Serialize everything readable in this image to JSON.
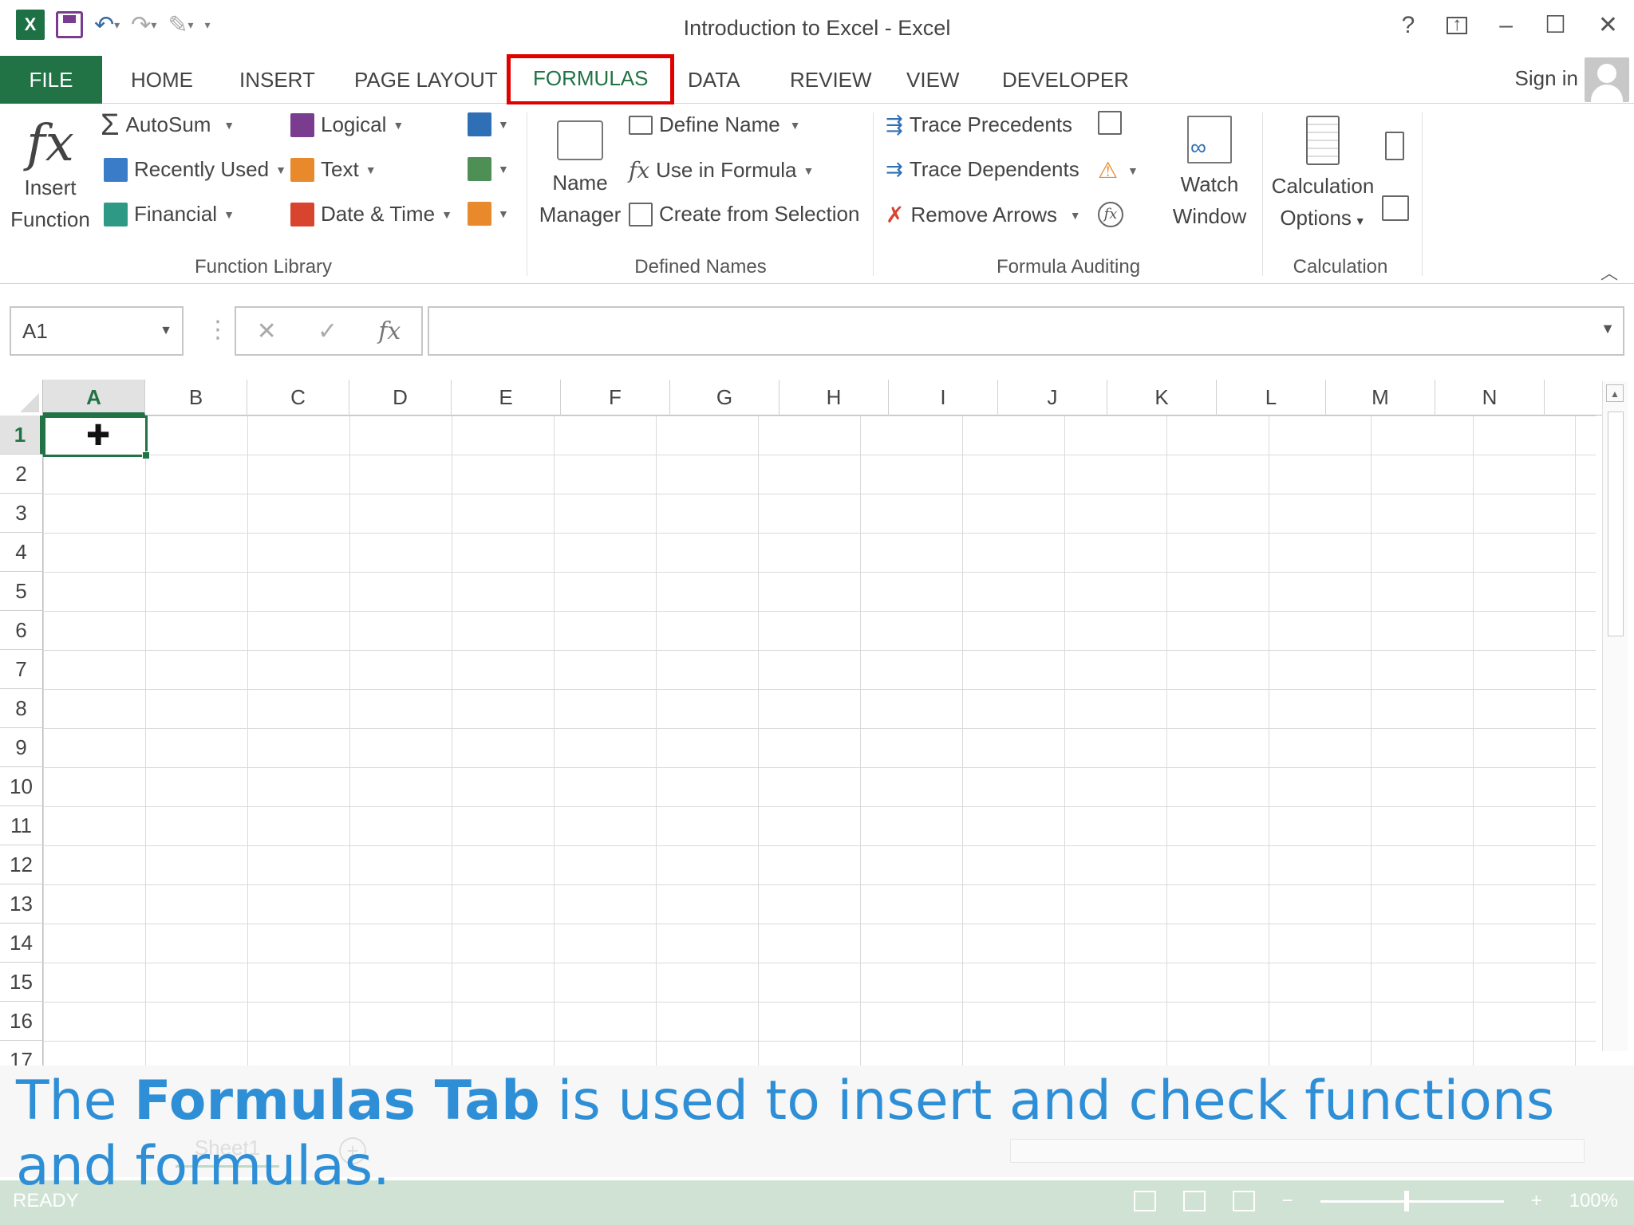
{
  "window": {
    "title": "Introduction to Excel - Excel",
    "help": "?",
    "sign_in": "Sign in"
  },
  "tabs": [
    {
      "label": "FILE"
    },
    {
      "label": "HOME"
    },
    {
      "label": "INSERT"
    },
    {
      "label": "PAGE LAYOUT"
    },
    {
      "label": "FORMULAS",
      "selected": true
    },
    {
      "label": "DATA"
    },
    {
      "label": "REVIEW"
    },
    {
      "label": "VIEW"
    },
    {
      "label": "DEVELOPER"
    }
  ],
  "ribbon": {
    "function_library": {
      "label": "Function Library",
      "insert_function": [
        "Insert",
        "Function"
      ],
      "autosum": "AutoSum",
      "recently_used": "Recently Used",
      "financial": "Financial",
      "logical": "Logical",
      "text": "Text",
      "date_time": "Date & Time"
    },
    "defined_names": {
      "label": "Defined Names",
      "name_manager": [
        "Name",
        "Manager"
      ],
      "define_name": "Define Name",
      "use_in_formula": "Use in Formula",
      "create_from_selection": "Create from Selection"
    },
    "formula_auditing": {
      "label": "Formula Auditing",
      "trace_precedents": "Trace Precedents",
      "trace_dependents": "Trace Dependents",
      "remove_arrows": "Remove Arrows",
      "watch_window": [
        "Watch",
        "Window"
      ]
    },
    "calculation": {
      "label": "Calculation",
      "calculation_options": [
        "Calculation",
        "Options"
      ]
    }
  },
  "formula_bar": {
    "name_box": "A1",
    "cancel": "✕",
    "enter": "✓",
    "fx": "fx",
    "value": ""
  },
  "columns": [
    "A",
    "B",
    "C",
    "D",
    "E",
    "F",
    "G",
    "H",
    "I",
    "J",
    "K",
    "L",
    "M",
    "N"
  ],
  "rows": [
    "1",
    "2",
    "3",
    "4",
    "5",
    "6",
    "7",
    "8",
    "9",
    "10",
    "11",
    "12",
    "13",
    "14",
    "15",
    "16",
    "17"
  ],
  "active_cell": "A1",
  "sheet_tab": "Sheet1",
  "status": {
    "ready": "READY",
    "zoom": "100%"
  },
  "caption": {
    "before": "The ",
    "bold": "Formulas Tab",
    "after": " is used to insert and check functions and formulas."
  },
  "colors": {
    "excel_green": "#217346",
    "highlight_red": "#e00000",
    "caption_blue": "#2e8fd6"
  }
}
